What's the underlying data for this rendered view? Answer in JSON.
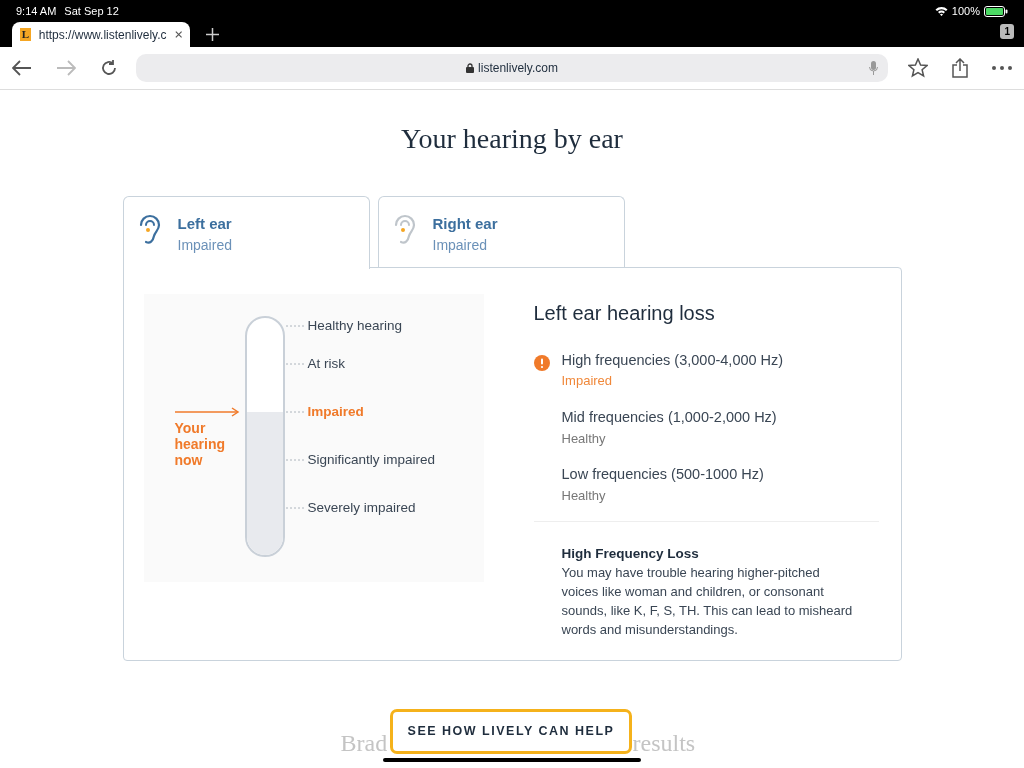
{
  "status_bar": {
    "time": "9:14 AM",
    "date": "Sat Sep 12",
    "battery": "100%"
  },
  "browser": {
    "tab": {
      "favicon": "L",
      "title": "https://www.listenlively.c"
    },
    "tab_count": "1",
    "address": "listenlively.com"
  },
  "page": {
    "heading": "Your hearing by ear",
    "ear_tabs": [
      {
        "label": "Left ear",
        "status": "Impaired",
        "selected": true
      },
      {
        "label": "Right ear",
        "status": "Impaired",
        "selected": false
      }
    ],
    "meter": {
      "level": 0.6,
      "pointer": "Your hearing now",
      "levels": [
        {
          "label": "Healthy hearing",
          "selected": false
        },
        {
          "label": "At risk",
          "selected": false
        },
        {
          "label": "Impaired",
          "selected": true
        },
        {
          "label": "Significantly impaired",
          "selected": false
        },
        {
          "label": "Severely impaired",
          "selected": false
        }
      ]
    },
    "loss_title": "Left ear hearing loss",
    "frequencies": [
      {
        "name": "High frequencies (3,000-4,000 Hz)",
        "status": "Impaired",
        "alert": true
      },
      {
        "name": "Mid frequencies (1,000-2,000 Hz)",
        "status": "Healthy",
        "alert": false
      },
      {
        "name": "Low frequencies (500-1000 Hz)",
        "status": "Healthy",
        "alert": false
      }
    ],
    "explanation": {
      "title": "High Frequency Loss",
      "text": "You may have trouble hearing higher-pitched voices like woman and children, or consonant sounds, like K, F, S, TH. This can lead to misheard words and misunderstandings."
    },
    "faded_heading": [
      "Brad",
      "results"
    ],
    "cta": "SEE HOW LIVELY CAN HELP"
  }
}
